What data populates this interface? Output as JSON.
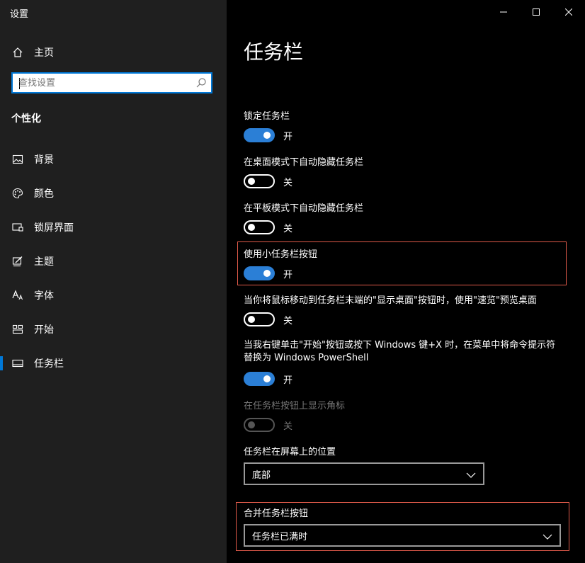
{
  "app": {
    "title": "设置"
  },
  "window_controls": {
    "minimize": "minimize-icon",
    "maximize": "maximize-icon",
    "close": "close-icon"
  },
  "sidebar": {
    "home_label": "主页",
    "search_placeholder": "查找设置",
    "section_title": "个性化",
    "items": [
      {
        "label": "背景",
        "icon": "picture-icon"
      },
      {
        "label": "颜色",
        "icon": "palette-icon"
      },
      {
        "label": "锁屏界面",
        "icon": "lock-screen-icon"
      },
      {
        "label": "主题",
        "icon": "theme-icon"
      },
      {
        "label": "字体",
        "icon": "font-icon"
      },
      {
        "label": "开始",
        "icon": "start-icon"
      },
      {
        "label": "任务栏",
        "icon": "taskbar-icon",
        "selected": true
      }
    ]
  },
  "main": {
    "title": "任务栏",
    "settings": [
      {
        "label": "锁定任务栏",
        "state": "on",
        "state_text": "开"
      },
      {
        "label": "在桌面模式下自动隐藏任务栏",
        "state": "off",
        "state_text": "关"
      },
      {
        "label": "在平板模式下自动隐藏任务栏",
        "state": "off",
        "state_text": "关"
      },
      {
        "label": "使用小任务栏按钮",
        "state": "on",
        "state_text": "开",
        "highlighted": true
      },
      {
        "label": "当你将鼠标移动到任务栏末端的\"显示桌面\"按钮时，使用\"速览\"预览桌面",
        "state": "off",
        "state_text": "关"
      },
      {
        "label": "当我右键单击\"开始\"按钮或按下 Windows 键+X 时，在菜单中将命令提示符替换为 Windows PowerShell",
        "state": "on",
        "state_text": "开"
      },
      {
        "label": "在任务栏按钮上显示角标",
        "state": "disabled",
        "state_text": "关"
      }
    ],
    "position": {
      "label": "任务栏在屏幕上的位置",
      "value": "底部"
    },
    "combine": {
      "label": "合并任务栏按钮",
      "value": "任务栏已满时",
      "highlighted": true
    }
  },
  "colors": {
    "accent": "#0078d7",
    "toggle_on": "#2b7fd6",
    "highlight_border": "#e05a4a",
    "sidebar_bg": "#1f1f1f"
  }
}
